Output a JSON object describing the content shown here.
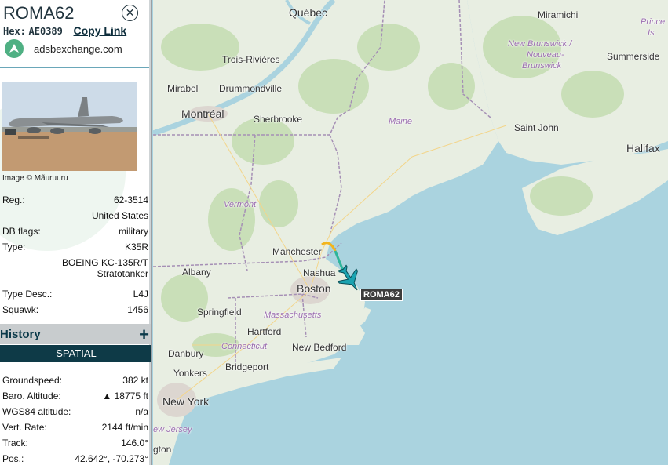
{
  "aircraft": {
    "callsign": "ROMA62",
    "hex_label": "Hex:",
    "hex": "AE0389",
    "copy_link": "Copy Link",
    "site": "adsbexchange.com",
    "image_credit": "Image © Mãuruuru"
  },
  "details": [
    {
      "label": "Reg.:",
      "value": "62-3514"
    },
    {
      "label": "",
      "value": "United States"
    },
    {
      "label": "DB flags:",
      "value": "military"
    },
    {
      "label": "Type:",
      "value": "K35R"
    },
    {
      "label": "",
      "value": "BOEING KC-135R/T"
    },
    {
      "label": "",
      "value": "Stratotanker"
    },
    {
      "label": "Type Desc.:",
      "value": "L4J"
    },
    {
      "label": "Squawk:",
      "value": "1456"
    }
  ],
  "history": {
    "title": "History",
    "plus": "+"
  },
  "spatial": {
    "title": "SPATIAL"
  },
  "spatial_rows": [
    {
      "label": "Groundspeed:",
      "value": "382 kt"
    },
    {
      "label": "Baro. Altitude:",
      "value": "▲ 18775 ft"
    },
    {
      "label": "WGS84 altitude:",
      "value": "n/a"
    },
    {
      "label": "Vert. Rate:",
      "value": "2144 ft/min"
    },
    {
      "label": "Track:",
      "value": "146.0°"
    },
    {
      "label": "Pos.:",
      "value": "42.642°, -70.273°"
    }
  ],
  "map": {
    "aircraft_label": "ROMA62",
    "labels": {
      "quebec": "Québec",
      "miramichi": "Miramichi",
      "prince": "Prince",
      "is": "Is",
      "nb1": "New Brunswick /",
      "nb2": "Nouveau-",
      "nb3": "Brunswick",
      "summerside": "Summerside",
      "trois": "Trois-Rivières",
      "mirabel": "Mirabel",
      "drummondville": "Drummondville",
      "montreal": "Montréal",
      "sherbrooke": "Sherbrooke",
      "maine": "Maine",
      "saint_john": "Saint John",
      "halifax": "Halifax",
      "vermont": "Vermont",
      "manchester": "Manchester",
      "albany": "Albany",
      "nashua": "Nashua",
      "boston": "Boston",
      "springfield": "Springfield",
      "massachusetts": "Massachusetts",
      "hartford": "Hartford",
      "connecticut": "Connecticut",
      "new_bedford": "New Bedford",
      "danbury": "Danbury",
      "yonkers": "Yonkers",
      "bridgeport": "Bridgeport",
      "new_york": "New York",
      "new_jersey": "ew Jersey",
      "arlington": "gton"
    }
  }
}
